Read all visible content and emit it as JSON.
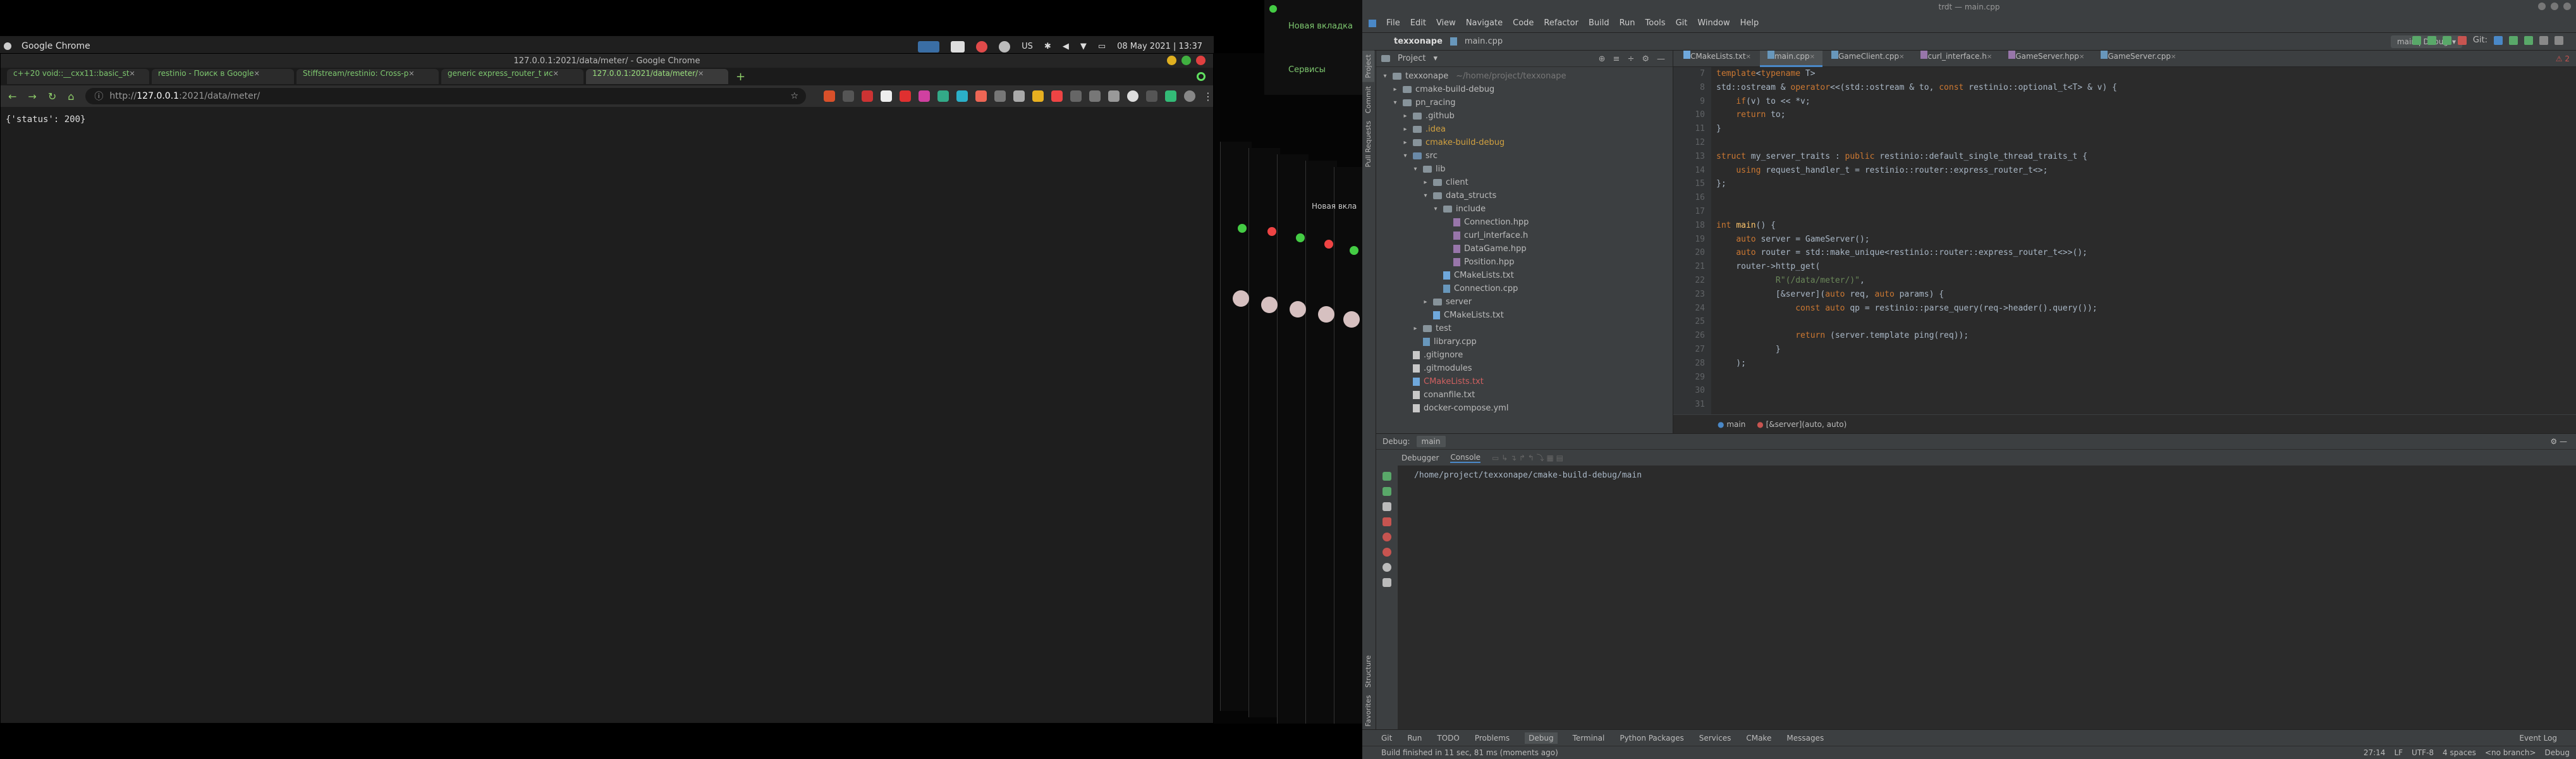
{
  "system_panel": {
    "app_title": "Google Chrome",
    "keyboard_layout": "US",
    "datetime": "08 May 2021 | 13:37"
  },
  "chrome": {
    "window_title": "127.0.0.1:2021/data/meter/ - Google Chrome",
    "tabs": [
      {
        "label": "c++20 void::__cxx11::basic_st",
        "active": false
      },
      {
        "label": "restinio - Поиск в Google",
        "active": false
      },
      {
        "label": "Stiffstream/restinio: Cross-p",
        "active": false
      },
      {
        "label": "generic express_router_t ис",
        "active": false
      },
      {
        "label": "127.0.0.1:2021/data/meter/",
        "active": true
      }
    ],
    "url_prefix": "http://",
    "url_host": "127.0.0.1",
    "url_path": ":2021/data/meter/",
    "content": "{'status': 200}"
  },
  "mini_window": {
    "title": "Новая вкладка",
    "link": "Сервисы"
  },
  "stack_label": "Новая вкла",
  "ide": {
    "window_title": "trdt — main.cpp",
    "menu": [
      "File",
      "Edit",
      "View",
      "Navigate",
      "Code",
      "Refactor",
      "Build",
      "Run",
      "Tools",
      "Git",
      "Window",
      "Help"
    ],
    "nav_project": "texxonape",
    "nav_file": "main.cpp",
    "run_config": "main | Debug",
    "git_label": "Git:",
    "left_tabs": [
      "Project",
      "Commit",
      "Pull Requests"
    ],
    "left_tabs_bottom": [
      "Structure",
      "Favorites"
    ],
    "project_header": "Project",
    "tree": [
      {
        "depth": 0,
        "icon": "folder",
        "label": "texxonape",
        "hint": "~/home/project/texxonape",
        "caret": "▾"
      },
      {
        "depth": 1,
        "icon": "folder",
        "label": "cmake-build-debug",
        "caret": "▸"
      },
      {
        "depth": 1,
        "icon": "folder",
        "label": "pn_racing",
        "caret": "▾"
      },
      {
        "depth": 2,
        "icon": "folder",
        "label": ".github",
        "caret": "▸"
      },
      {
        "depth": 2,
        "icon": "folder",
        "label": ".idea",
        "caret": "▸",
        "color": "#d0a040"
      },
      {
        "depth": 2,
        "icon": "folder",
        "label": "cmake-build-debug",
        "caret": "▸",
        "color": "#d0a040"
      },
      {
        "depth": 2,
        "icon": "folder-src",
        "label": "src",
        "caret": "▾"
      },
      {
        "depth": 3,
        "icon": "folder",
        "label": "lib",
        "caret": "▾"
      },
      {
        "depth": 4,
        "icon": "folder",
        "label": "client",
        "caret": "▸"
      },
      {
        "depth": 4,
        "icon": "folder",
        "label": "data_structs",
        "caret": "▾"
      },
      {
        "depth": 5,
        "icon": "folder",
        "label": "include",
        "caret": "▾"
      },
      {
        "depth": 6,
        "icon": "file-h",
        "label": "Connection.hpp"
      },
      {
        "depth": 6,
        "icon": "file-h",
        "label": "curl_interface.h"
      },
      {
        "depth": 6,
        "icon": "file-h",
        "label": "DataGame.hpp"
      },
      {
        "depth": 6,
        "icon": "file-h",
        "label": "Position.hpp"
      },
      {
        "depth": 5,
        "icon": "file-cm",
        "label": "CMakeLists.txt"
      },
      {
        "depth": 5,
        "icon": "file-cpp",
        "label": "Connection.cpp"
      },
      {
        "depth": 4,
        "icon": "folder",
        "label": "server",
        "caret": "▸"
      },
      {
        "depth": 4,
        "icon": "file-cm",
        "label": "CMakeLists.txt"
      },
      {
        "depth": 3,
        "icon": "folder",
        "label": "test",
        "caret": "▸"
      },
      {
        "depth": 3,
        "icon": "file-cpp",
        "label": "library.cpp"
      },
      {
        "depth": 2,
        "icon": "file-txt",
        "label": ".gitignore"
      },
      {
        "depth": 2,
        "icon": "file-txt",
        "label": ".gitmodules"
      },
      {
        "depth": 2,
        "icon": "file-cm",
        "label": "CMakeLists.txt",
        "color": "#d06060"
      },
      {
        "depth": 2,
        "icon": "file-txt",
        "label": "conanfile.txt"
      },
      {
        "depth": 2,
        "icon": "file-txt",
        "label": "docker-compose.yml"
      }
    ],
    "editor_tabs": [
      {
        "label": "CMakeLists.txt",
        "active": false
      },
      {
        "label": "main.cpp",
        "active": true
      },
      {
        "label": "GameClient.cpp",
        "active": false
      },
      {
        "label": "curl_interface.h",
        "active": false
      },
      {
        "label": "GameServer.hpp",
        "active": false
      },
      {
        "label": "GameServer.cpp",
        "active": false
      }
    ],
    "inspection_count": "2",
    "code_lines": [
      {
        "n": "7",
        "html": "<span class='kw'>template</span><span class='pl'>&lt;</span><span class='kw'>typename</span><span class='pl'> T&gt;</span>"
      },
      {
        "n": "8",
        "html": "<span class='pl'>std::ostream &amp; </span><span class='kw'>operator</span><span class='pl'>&lt;&lt;(std::ostream &amp; to, </span><span class='kw'>const</span><span class='pl'> restinio::optional_t&lt;T&gt; &amp; v) {</span>"
      },
      {
        "n": "9",
        "html": "<span class='pl'>    </span><span class='kw'>if</span><span class='pl'>(v) to &lt;&lt; *v;</span>"
      },
      {
        "n": "10",
        "html": "<span class='pl'>    </span><span class='kw'>return</span><span class='pl'> to;</span>"
      },
      {
        "n": "11",
        "html": "<span class='pl'>}</span>"
      },
      {
        "n": "12",
        "html": ""
      },
      {
        "n": "13",
        "html": "<span class='kw'>struct</span><span class='pl'> my_server_traits : </span><span class='kw'>public</span><span class='pl'> restinio::default_single_thread_traits_t {</span>"
      },
      {
        "n": "14",
        "html": "<span class='pl'>    </span><span class='kw'>using</span><span class='pl'> request_handler_t = restinio::router::express_router_t&lt;&gt;;</span>"
      },
      {
        "n": "15",
        "html": "<span class='pl'>};</span>"
      },
      {
        "n": "16",
        "html": ""
      },
      {
        "n": "17",
        "html": ""
      },
      {
        "n": "18",
        "html": "<span class='kw'>int</span><span class='pl'> </span><span class='fn'>main</span><span class='pl'>() {</span>"
      },
      {
        "n": "19",
        "html": "<span class='pl'>    </span><span class='kw'>auto</span><span class='pl'> server = GameServer();</span>"
      },
      {
        "n": "20",
        "html": "<span class='pl'>    </span><span class='kw'>auto</span><span class='pl'> router = std::make_unique&lt;restinio::router::express_router_t&lt;&gt;&gt;();</span>"
      },
      {
        "n": "21",
        "html": "<span class='pl'>    router-&gt;http_get(</span>"
      },
      {
        "n": "22",
        "html": "<span class='st'>            R\"(/data/meter/)\"</span><span class='pl'>,</span>"
      },
      {
        "n": "23",
        "html": "<span class='pl'>            [&amp;server](</span><span class='kw'>auto</span><span class='pl'> req, </span><span class='kw'>auto</span><span class='pl'> params) {</span>"
      },
      {
        "n": "24",
        "html": "<span class='pl'>                </span><span class='kw'>const auto</span><span class='pl'> qp = restinio::parse_query(req-&gt;header().query());</span>"
      },
      {
        "n": "25",
        "html": ""
      },
      {
        "n": "26",
        "html": "<span class='pl'>                </span><span class='kw'>return</span><span class='pl'> (server.template ping(req));</span>"
      },
      {
        "n": "27",
        "html": "<span class='pl'>            }</span>"
      },
      {
        "n": "28",
        "html": "<span class='pl'>    );</span>"
      },
      {
        "n": "29",
        "html": ""
      },
      {
        "n": "30",
        "html": ""
      },
      {
        "n": "31",
        "html": ""
      }
    ],
    "breadcrumb": [
      "main",
      "[&server](auto, auto)"
    ],
    "debug_label": "Debug:",
    "debug_config": "main",
    "debug_tabs": [
      "Debugger",
      "Console"
    ],
    "console_text": "/home/project/texxonape/cmake-build-debug/main",
    "tool_windows": [
      "Git",
      "Run",
      "TODO",
      "Problems",
      "Debug",
      "Terminal",
      "Python Packages",
      "Services",
      "CMake",
      "Messages"
    ],
    "event_log": "Event Log",
    "status_message": "Build finished in 11 sec, 81 ms (moments ago)",
    "status_right": [
      "27:14",
      "LF",
      "UTF-8",
      "4 spaces"
    ],
    "git_branch": "<no branch>",
    "debug_status": "Debug"
  }
}
